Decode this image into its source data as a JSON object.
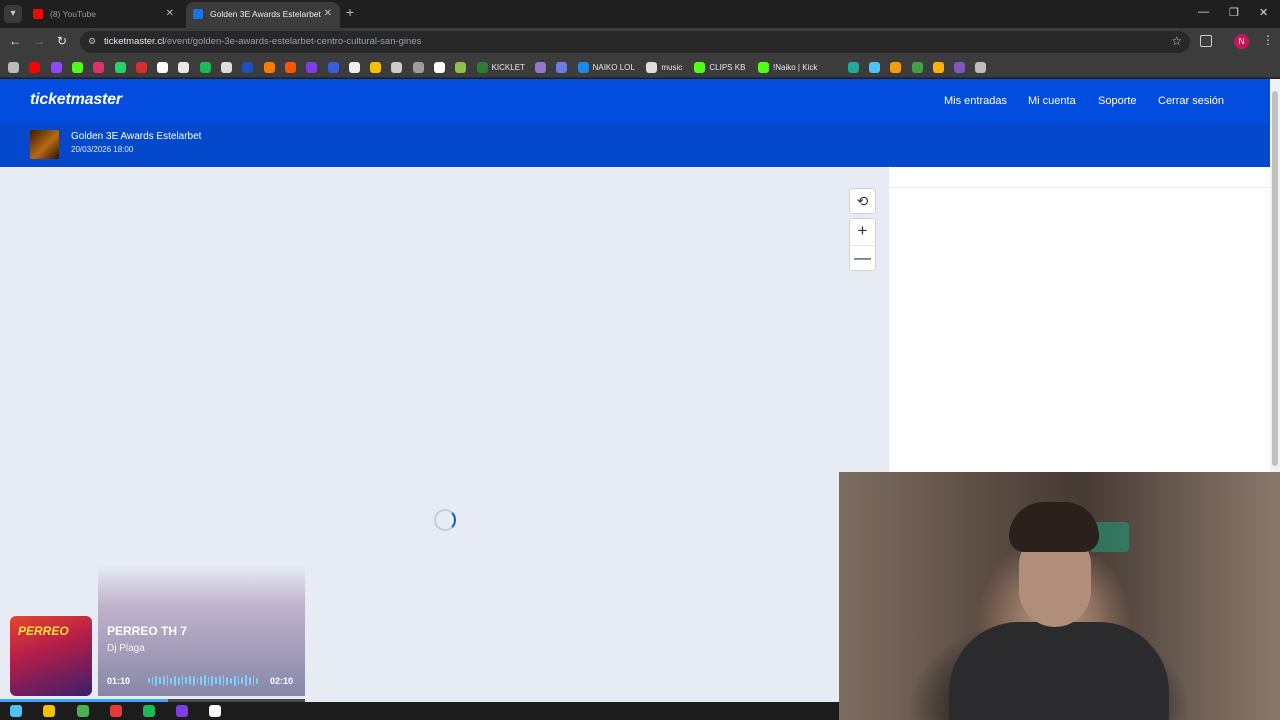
{
  "browser": {
    "tabs": [
      {
        "title": "(8) YouTube",
        "favicon_color": "#ff0000",
        "active": false
      },
      {
        "title": "Golden 3E Awards Estelarbet",
        "favicon_color": "#1a73e8",
        "active": true
      }
    ],
    "url_host": "ticketmaster.cl",
    "url_path": "/event/golden-3e-awards-estelarbet-centro-cultural-san-gines",
    "profile_initial": "N",
    "bookmarks": [
      {
        "label": "",
        "icon": "apps-grid-icon",
        "color": "#bbbbbb"
      },
      {
        "label": "",
        "icon": "youtube-icon",
        "color": "#ff0000"
      },
      {
        "label": "",
        "icon": "twitch-icon",
        "color": "#9146ff"
      },
      {
        "label": "",
        "icon": "kick-icon",
        "color": "#53fc18"
      },
      {
        "label": "",
        "icon": "instagram-icon",
        "color": "#e1306c"
      },
      {
        "label": "",
        "icon": "whatsapp-icon",
        "color": "#25d366"
      },
      {
        "label": "",
        "icon": "red-icon",
        "color": "#d32f2f"
      },
      {
        "label": "",
        "icon": "x-icon",
        "color": "#ffffff"
      },
      {
        "label": "",
        "icon": "tiktok-icon",
        "color": "#e8e8e8"
      },
      {
        "label": "",
        "icon": "spotify-icon",
        "color": "#1db954"
      },
      {
        "label": "",
        "icon": "s-icon",
        "color": "#dddddd"
      },
      {
        "label": "",
        "icon": "blue-icon",
        "color": "#1e4fbf"
      },
      {
        "label": "",
        "icon": "cloud-icon",
        "color": "#f57c00"
      },
      {
        "label": "",
        "icon": "soundcloud-icon",
        "color": "#ff5500"
      },
      {
        "label": "",
        "icon": "purple-icon",
        "color": "#7b3fe4"
      },
      {
        "label": "",
        "icon": "search-icon",
        "color": "#3b5bdb"
      },
      {
        "label": "",
        "icon": "globe-icon",
        "color": "#eeeeee"
      },
      {
        "label": "",
        "icon": "yellow-icon",
        "color": "#f2c200"
      },
      {
        "label": "",
        "icon": "cat-icon",
        "color": "#cccccc"
      },
      {
        "label": "",
        "icon": "image-icon",
        "color": "#9e9e9e"
      },
      {
        "label": "",
        "icon": "diamond-icon",
        "color": "#ffffff"
      },
      {
        "label": "",
        "icon": "leaf-icon",
        "color": "#8bc34a"
      },
      {
        "label": "KICKLET",
        "icon": "kicklet-icon",
        "color": "#2e7d32"
      },
      {
        "label": "",
        "icon": "discord-icon",
        "color": "#9575cd"
      },
      {
        "label": "",
        "icon": "shield-icon",
        "color": "#6a7fdb"
      },
      {
        "label": "NAIKO LOL",
        "icon": "l-icon",
        "color": "#1e88e5"
      },
      {
        "label": "music",
        "icon": "key-icon",
        "color": "#dddddd"
      },
      {
        "label": "CLIPS KB",
        "icon": "clips-icon",
        "color": "#53fc18"
      },
      {
        "label": "!Naiko | Kick",
        "icon": "kick-icon",
        "color": "#53fc18"
      },
      {
        "label": "",
        "icon": "green-icon",
        "color": "#26a69a"
      },
      {
        "label": "",
        "icon": "bars-icon",
        "color": "#4fc3f7"
      },
      {
        "label": "",
        "icon": "orange-icon",
        "color": "#f59e0b"
      },
      {
        "label": "",
        "icon": "plus-green-icon",
        "color": "#43a047"
      },
      {
        "label": "",
        "icon": "u-icon",
        "color": "#ffb300"
      },
      {
        "label": "",
        "icon": "swirl-icon",
        "color": "#7e57c2"
      },
      {
        "label": "",
        "icon": "square-icon",
        "color": "#bdbdbd"
      }
    ]
  },
  "site": {
    "logo": "ticketmaster",
    "nav": [
      "Mis entradas",
      "Mi cuenta",
      "Soporte",
      "Cerrar sesión"
    ],
    "event_title": "Golden 3E Awards Estelarbet",
    "event_date": "20/03/2026 18:00",
    "brand_color": "#024ddf",
    "map_loading": true
  },
  "player": {
    "cover_text": "PERREO",
    "song": "PERREO TH 7",
    "artist": "Dj Plaga",
    "time_current": "01:10",
    "time_total": "02:10",
    "progress_fraction": 0.55
  },
  "taskbar": {
    "icons": [
      {
        "icon": "windows-icon",
        "color": "#4fc3f7"
      },
      {
        "icon": "explorer-icon",
        "color": "#f2c200"
      },
      {
        "icon": "chrome-icon",
        "color": "#4caf50"
      },
      {
        "icon": "record-icon",
        "color": "#e53935"
      },
      {
        "icon": "spotify-icon",
        "color": "#1db954"
      },
      {
        "icon": "discord-icon",
        "color": "#7b3fe4"
      },
      {
        "icon": "app-icon",
        "color": "#ffffff"
      }
    ]
  }
}
